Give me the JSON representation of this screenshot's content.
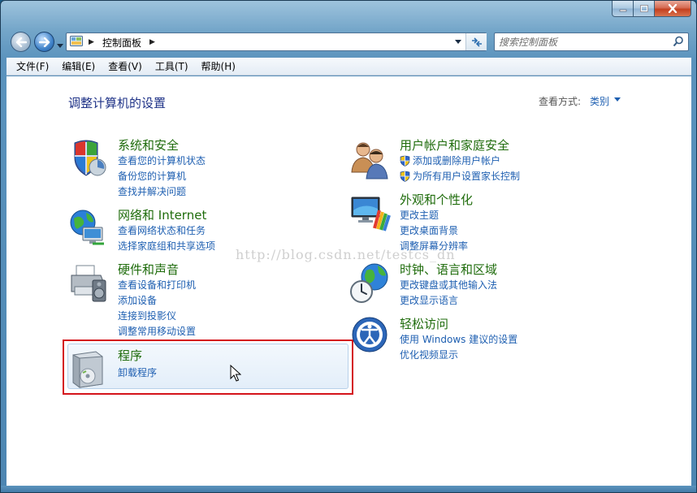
{
  "window": {
    "caption_buttons": [
      "minimize-icon",
      "maximize-icon",
      "close-icon"
    ]
  },
  "address_bar": {
    "crumb": "控制面板",
    "icon": "control-panel-icon"
  },
  "search": {
    "placeholder": "搜索控制面板"
  },
  "menubar": {
    "items": [
      "文件(F)",
      "编辑(E)",
      "查看(V)",
      "工具(T)",
      "帮助(H)"
    ]
  },
  "page": {
    "title": "调整计算机的设置",
    "view_by_label": "查看方式:",
    "view_by_value": "类别"
  },
  "categories": {
    "system_security": {
      "title": "系统和安全",
      "links": [
        "查看您的计算机状态",
        "备份您的计算机",
        "查找并解决问题"
      ]
    },
    "network": {
      "title": "网络和 Internet",
      "links": [
        "查看网络状态和任务",
        "选择家庭组和共享选项"
      ]
    },
    "hardware": {
      "title": "硬件和声音",
      "links": [
        "查看设备和打印机",
        "添加设备",
        "连接到投影仪",
        "调整常用移动设置"
      ]
    },
    "programs": {
      "title": "程序",
      "links": [
        "卸载程序"
      ]
    },
    "user_accounts": {
      "title": "用户帐户和家庭安全",
      "links": [
        "添加或删除用户帐户",
        "为所有用户设置家长控制"
      ]
    },
    "appearance": {
      "title": "外观和个性化",
      "links": [
        "更改主题",
        "更改桌面背景",
        "调整屏幕分辨率"
      ]
    },
    "clock": {
      "title": "时钟、语言和区域",
      "links": [
        "更改键盘或其他输入法",
        "更改显示语言"
      ]
    },
    "ease": {
      "title": "轻松访问",
      "links": [
        "使用 Windows 建议的设置",
        "优化视频显示"
      ]
    }
  },
  "watermark": "http://blog.csdn.net/testcs_dn",
  "colors": {
    "category_title": "#1f6c0c",
    "link": "#1e5fb1",
    "page_title": "#1e3287",
    "highlight_border": "#d4131a"
  }
}
